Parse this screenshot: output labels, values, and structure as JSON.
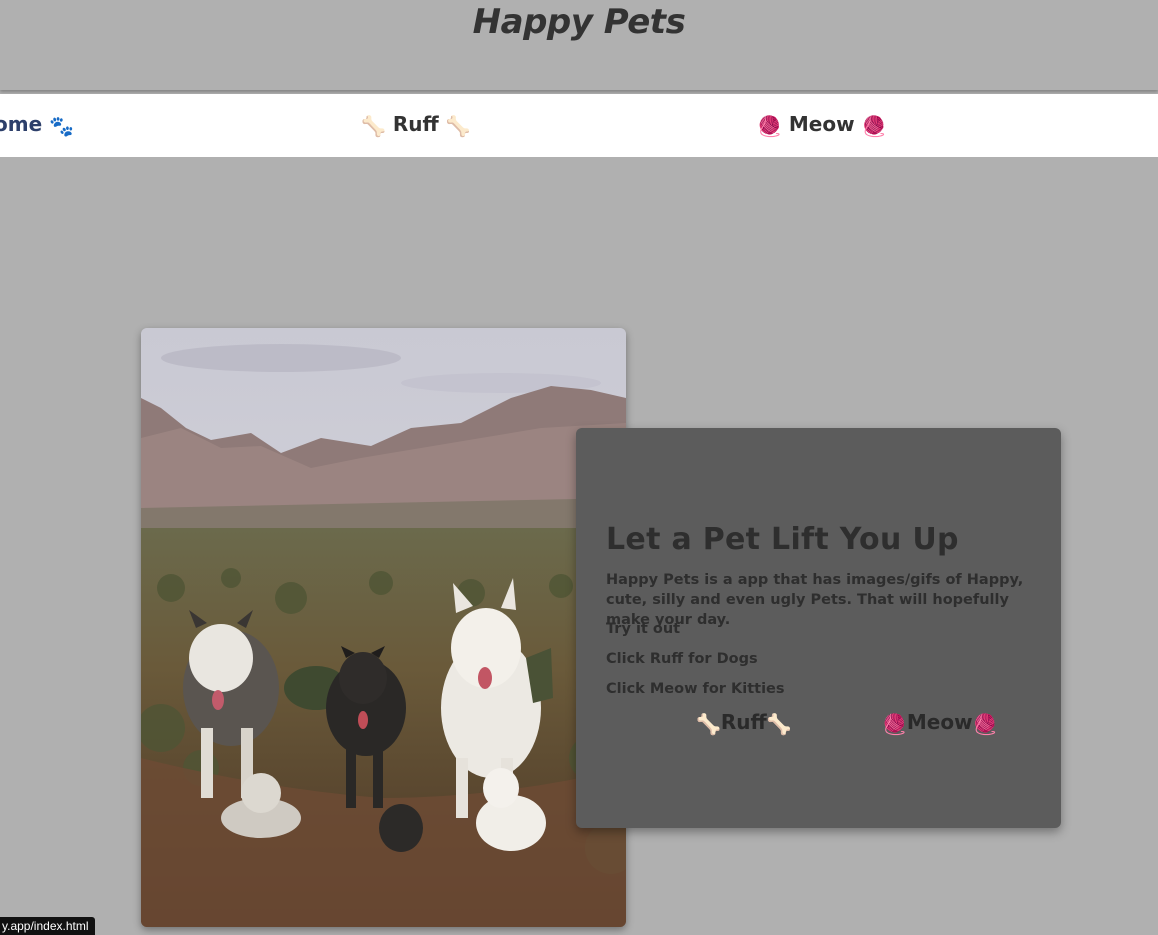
{
  "header": {
    "title": "Happy Pets"
  },
  "nav": {
    "home_label": "ome",
    "home_icon": "🐾",
    "ruff_label": "Ruff",
    "ruff_icon": "🦴",
    "meow_label": "Meow",
    "meow_icon": "🧶"
  },
  "hero": {
    "image_subject": "dogs-in-desert-photo"
  },
  "card": {
    "title": "Let a Pet Lift You Up",
    "description": "Happy Pets is a app that has images/gifs of Happy, cute, silly and even ugly Pets. That will hopefully make your day.",
    "line1": "Try it out",
    "line2": "Click Ruff for Dogs",
    "line3": "Click Meow for Kitties",
    "ruff_button": "Ruff",
    "meow_button": "Meow",
    "bone_icon": "🦴",
    "yarn_icon": "🧶"
  },
  "status_bar": {
    "url": "y.app/index.html"
  },
  "colors": {
    "page_bg": "#b0b0b0",
    "navbar_bg": "#ffffff",
    "card_bg": "#5c5c5c",
    "home_link": "#2d3f6a"
  }
}
